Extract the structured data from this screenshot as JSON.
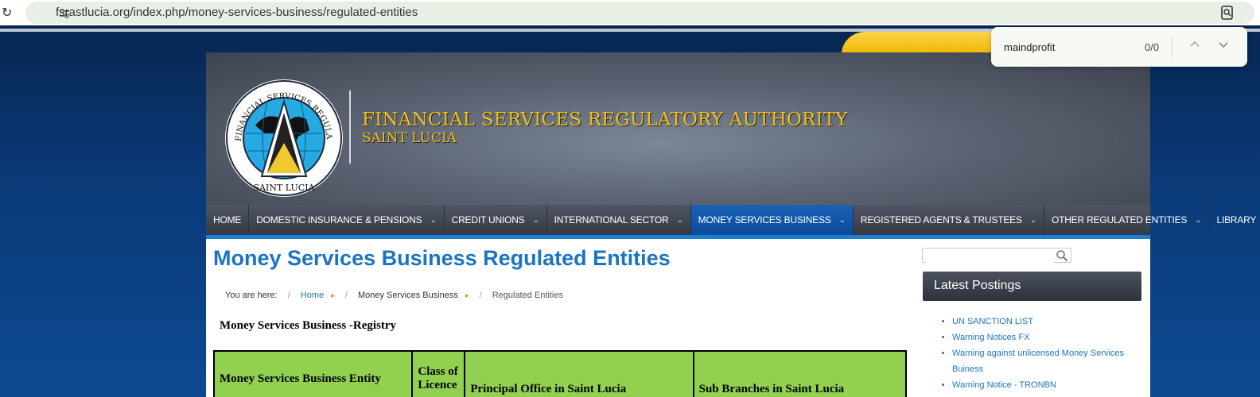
{
  "browser": {
    "url": "fsrastlucia.org/index.php/money-services-business/regulated-entities",
    "find": {
      "query": "maindprofit",
      "count": "0/0"
    }
  },
  "header": {
    "title": "FINANCIAL SERVICES  REGULATORY AUTHORITY",
    "subtitle": "SAINT LUCIA",
    "logo_ring_top": "FINANCIAL SERVICES REGULATORY AUTHORITY",
    "logo_ring_bottom": "SAINT LUCIA"
  },
  "nav": {
    "items": [
      {
        "label": "HOME",
        "has_menu": false
      },
      {
        "label": "DOMESTIC INSURANCE & PENSIONS",
        "has_menu": true
      },
      {
        "label": "CREDIT UNIONS",
        "has_menu": true
      },
      {
        "label": "INTERNATIONAL SECTOR",
        "has_menu": true
      },
      {
        "label": "MONEY SERVICES BUSINESS",
        "has_menu": true,
        "active": true
      },
      {
        "label": "REGISTERED AGENTS & TRUSTEES",
        "has_menu": true
      },
      {
        "label": "OTHER REGULATED ENTITIES",
        "has_menu": true
      },
      {
        "label": "LIBRARY",
        "has_menu": true
      }
    ]
  },
  "content": {
    "heading": "Money Services Business Regulated Entities",
    "breadcrumb": {
      "prefix": "You are here:",
      "items": [
        "Home",
        "Money Services Business",
        "Regulated Entities"
      ]
    },
    "registry_title": "Money Services Business -Registry",
    "table_headers": [
      "Money Services Business Entity",
      "Class of Licence",
      "Principal Office in Saint Lucia",
      "Sub Branches in Saint Lucia"
    ]
  },
  "sidebar": {
    "search_placeholder": "",
    "latest_title": "Latest Postings",
    "postings": [
      "UN SANCTION LIST",
      "Warning Notices FX",
      "Warning against unlicensed Money Services Buiness",
      "Warning Notice - TRONBN"
    ]
  },
  "colors": {
    "accent_blue": "#1b74c3",
    "header_gold": "#f2c21a",
    "table_header_green": "#92d050",
    "nav_active": "#0b4b9a"
  }
}
